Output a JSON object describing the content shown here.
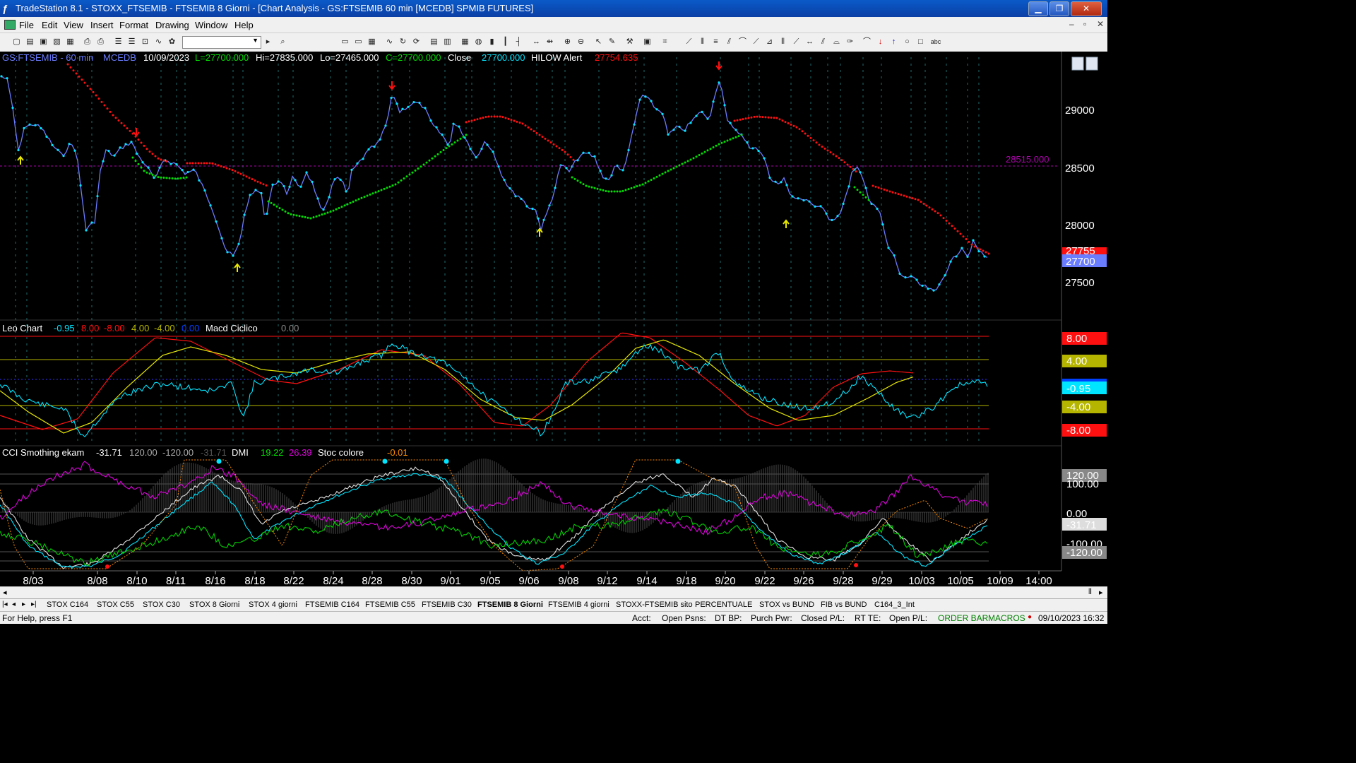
{
  "window": {
    "title": "TradeStation 8.1 - STOXX_FTSEMIB - FTSEMIB  8 Giorni - [Chart Analysis - GS:FTSEMIB  60 min  [MCEDB] SPMIB FUTURES]",
    "app_icon": "tradestation-icon"
  },
  "menu": [
    "File",
    "Edit",
    "View",
    "Insert",
    "Format",
    "Drawing",
    "Window",
    "Help"
  ],
  "toolbar": {
    "symbol_value": ""
  },
  "panel1": {
    "symbol": "GS:FTSEMIB - 60 min",
    "source": "MCEDB",
    "date": "10/09/2023",
    "last": "L=27700.000",
    "high": "Hi=27835.000",
    "low": "Lo=27465.000",
    "close_val": "C=27700.000",
    "close_label": "Close",
    "close_num": "27700.000",
    "alert_label": "HILOW Alert",
    "alert_val": "27754.635",
    "hline_label": "28515.000",
    "price_ticks": [
      "29000",
      "28500",
      "28000",
      "27500"
    ],
    "price_tag": "27700",
    "price_tag_red": "27755"
  },
  "panel2": {
    "name": "Leo Chart",
    "v1": "-0.95",
    "v2": "8.00",
    "v3": "-8.00",
    "v4": "4.00",
    "v5": "-4.00",
    "v6": "0.00",
    "name2": "Macd Ciclico",
    "v7": "0.00",
    "tags": [
      "8.00",
      "4.00",
      "-0.95",
      "-4.00",
      "-8.00"
    ]
  },
  "panel3": {
    "name": "CCI Smothing ekam",
    "v1": "-31.71",
    "v2": "120.00",
    "v3": "-120.00",
    "v4": "-31.71",
    "dmi": "DMI",
    "dmi1": "19.22",
    "dmi2": "26.39",
    "stoc": "Stoc colore",
    "stoc_val": "-0.01",
    "tags": [
      "120.00",
      "100.00",
      "0.00",
      "-31.71",
      "-100.00",
      "-120.00"
    ]
  },
  "xaxis": [
    "8/03",
    "8/08",
    "8/10",
    "8/11",
    "8/16",
    "8/18",
    "8/22",
    "8/24",
    "8/28",
    "8/30",
    "9/01",
    "9/05",
    "9/06",
    "9/08",
    "9/12",
    "9/14",
    "9/18",
    "9/20",
    "9/22",
    "9/26",
    "9/28",
    "9/29",
    "10/03",
    "10/05",
    "10/09",
    "14:00"
  ],
  "tabs": [
    "STOX C164",
    "STOX C55",
    "STOX  C30",
    "STOX  8 Giorni",
    "STOX 4 giorni",
    "FTSEMIB C164",
    "FTSEMIB C55",
    "FTSEMIB C30",
    "FTSEMIB  8 Giorni",
    "FTSEMIB  4 giorni",
    "STOXX-FTSEMIB sito",
    "PERCENTUALE",
    "STOX vs BUND",
    "FIB vs BUND",
    "C164_3_Int"
  ],
  "active_tab": "FTSEMIB  8 Giorni",
  "status": {
    "help": "For Help, press F1",
    "acct": "Acct:",
    "open_psns": "Open Psns:",
    "dt_bp": "DT BP:",
    "purch_pwr": "Purch Pwr:",
    "closed_pl": "Closed P/L:",
    "rt_te": "RT TE:",
    "open_pl": "Open P/L:",
    "order_bar": "ORDER BAR",
    "macros": "MACROS",
    "datetime": "09/10/2023 16:32"
  },
  "colors": {
    "price": "#6a7cff",
    "dots": "#00e5ff",
    "trend_up": "#00e000",
    "trend_down": "#ff1010",
    "hline": "#b000b0",
    "yellow": "#e8e800"
  }
}
